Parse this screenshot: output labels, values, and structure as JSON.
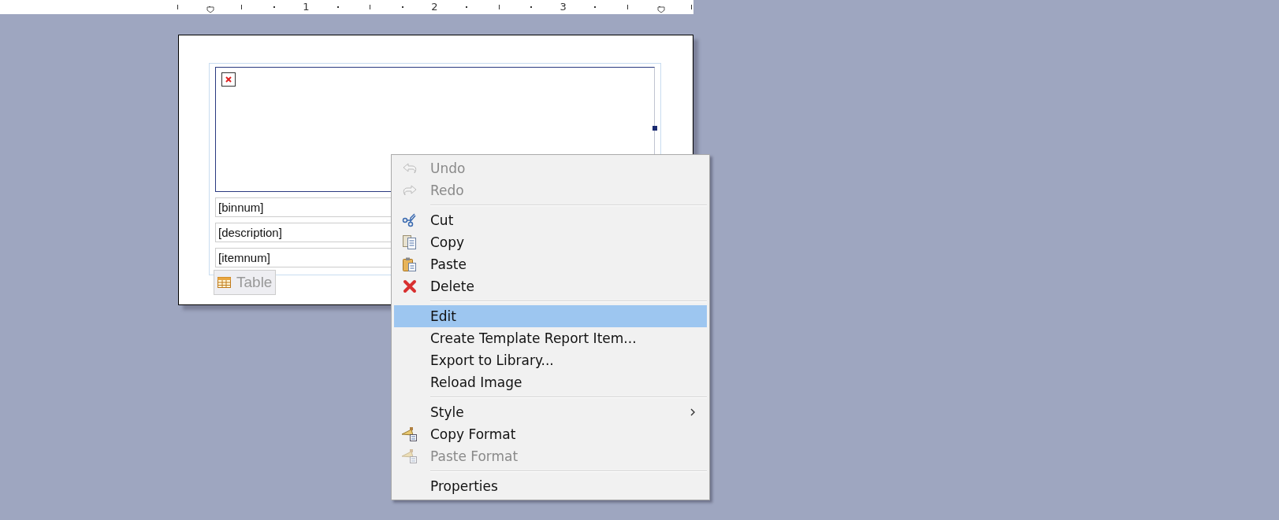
{
  "ruler": {
    "labels": [
      "1",
      "2",
      "3"
    ]
  },
  "report": {
    "image": {
      "kind": "broken-image"
    },
    "rows": [
      "[binnum]",
      "[description]",
      "[itemnum]"
    ],
    "table_tab": "Table"
  },
  "menu": {
    "items": [
      {
        "kind": "item",
        "label": "Undo",
        "disabled": true,
        "selected": false
      },
      {
        "kind": "item",
        "label": "Redo",
        "disabled": true,
        "selected": false
      },
      {
        "kind": "separator"
      },
      {
        "kind": "item",
        "label": "Cut",
        "disabled": false,
        "selected": false
      },
      {
        "kind": "item",
        "label": "Copy",
        "disabled": false,
        "selected": false
      },
      {
        "kind": "item",
        "label": "Paste",
        "disabled": false,
        "selected": false
      },
      {
        "kind": "item",
        "label": "Delete",
        "disabled": false,
        "selected": false
      },
      {
        "kind": "separator"
      },
      {
        "kind": "item",
        "label": "Edit",
        "disabled": false,
        "selected": true
      },
      {
        "kind": "item",
        "label": "Create Template Report Item...",
        "disabled": false,
        "selected": false
      },
      {
        "kind": "item",
        "label": "Export to Library...",
        "disabled": false,
        "selected": false
      },
      {
        "kind": "item",
        "label": "Reload Image",
        "disabled": false,
        "selected": false
      },
      {
        "kind": "separator"
      },
      {
        "kind": "submenu",
        "label": "Style",
        "disabled": false,
        "selected": false
      },
      {
        "kind": "item",
        "label": "Copy Format",
        "disabled": false,
        "selected": false
      },
      {
        "kind": "item",
        "label": "Paste Format",
        "disabled": true,
        "selected": false
      },
      {
        "kind": "separator"
      },
      {
        "kind": "item",
        "label": "Properties",
        "disabled": false,
        "selected": false
      }
    ]
  }
}
